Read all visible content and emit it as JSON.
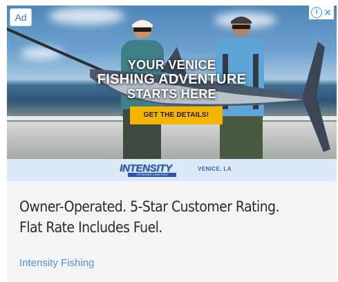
{
  "ad": {
    "badge_label": "Ad",
    "adchoices_info_glyph": "i",
    "adchoices_close_glyph": "✕",
    "headline_line1": "YOUR VENICE",
    "headline_line2": "FISHING ADVENTURE",
    "headline_line3": "STARTS HERE",
    "cta_label": "GET THE DETAILS!",
    "brand_name": "INTENSITY",
    "brand_tagline": "OFFSHORE CHARTERS",
    "brand_location": "VENICE, LA",
    "title": "Owner-Operated. 5-Star Customer Rating. Flat Rate Includes Fuel.",
    "advertiser": "Intensity Fishing"
  },
  "icons": {
    "info": "info-icon",
    "close": "close-icon"
  },
  "colors": {
    "cta_background": "#f4b400",
    "brand_blue": "#2f55a8",
    "strip_background": "#dce9f7",
    "advertiser_link": "#4a97d8",
    "text_area_background": "#f4f4f4"
  }
}
